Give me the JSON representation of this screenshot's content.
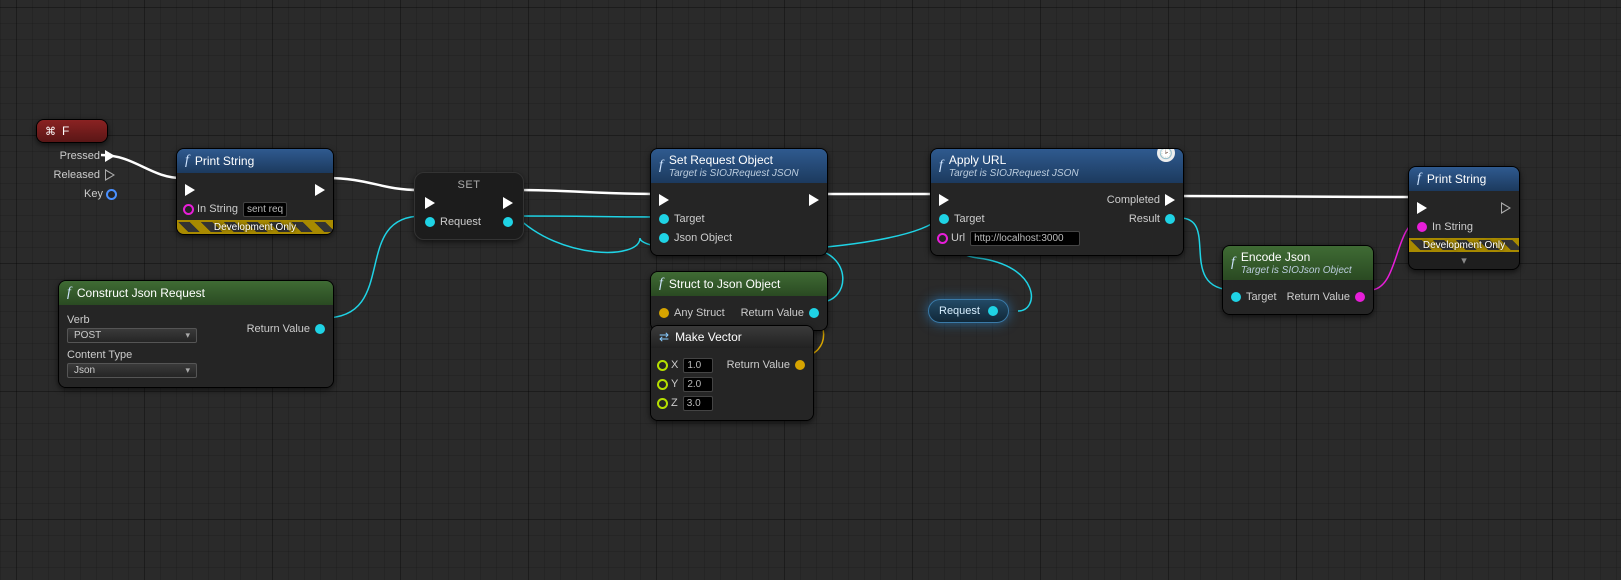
{
  "event": {
    "title": "F",
    "pressed": "Pressed",
    "released": "Released",
    "key": "Key"
  },
  "printString1": {
    "title": "Print String",
    "inString": "In String",
    "value": "sent req",
    "devOnly": "Development Only"
  },
  "set": {
    "title": "SET",
    "request": "Request"
  },
  "constructJson": {
    "title": "Construct Json Request",
    "verbLabel": "Verb",
    "verbValue": "POST",
    "contentTypeLabel": "Content Type",
    "contentTypeValue": "Json",
    "returnValue": "Return Value"
  },
  "setRequestObject": {
    "title": "Set Request Object",
    "sub": "Target is SIOJRequest JSON",
    "target": "Target",
    "jsonObject": "Json Object"
  },
  "structToJson": {
    "title": "Struct to Json Object",
    "anyStruct": "Any Struct",
    "returnValue": "Return Value"
  },
  "makeVector": {
    "title": "Make Vector",
    "x": "X",
    "xv": "1.0",
    "y": "Y",
    "yv": "2.0",
    "z": "Z",
    "zv": "3.0",
    "returnValue": "Return Value"
  },
  "applyUrl": {
    "title": "Apply URL",
    "sub": "Target is SIOJRequest JSON",
    "target": "Target",
    "url": "Url",
    "urlValue": "http://localhost:3000",
    "completed": "Completed",
    "result": "Result"
  },
  "requestVar": {
    "label": "Request"
  },
  "encodeJson": {
    "title": "Encode Json",
    "sub": "Target is SIOJson Object",
    "target": "Target",
    "returnValue": "Return Value"
  },
  "printString2": {
    "title": "Print String",
    "inString": "In String",
    "devOnly": "Development Only"
  }
}
